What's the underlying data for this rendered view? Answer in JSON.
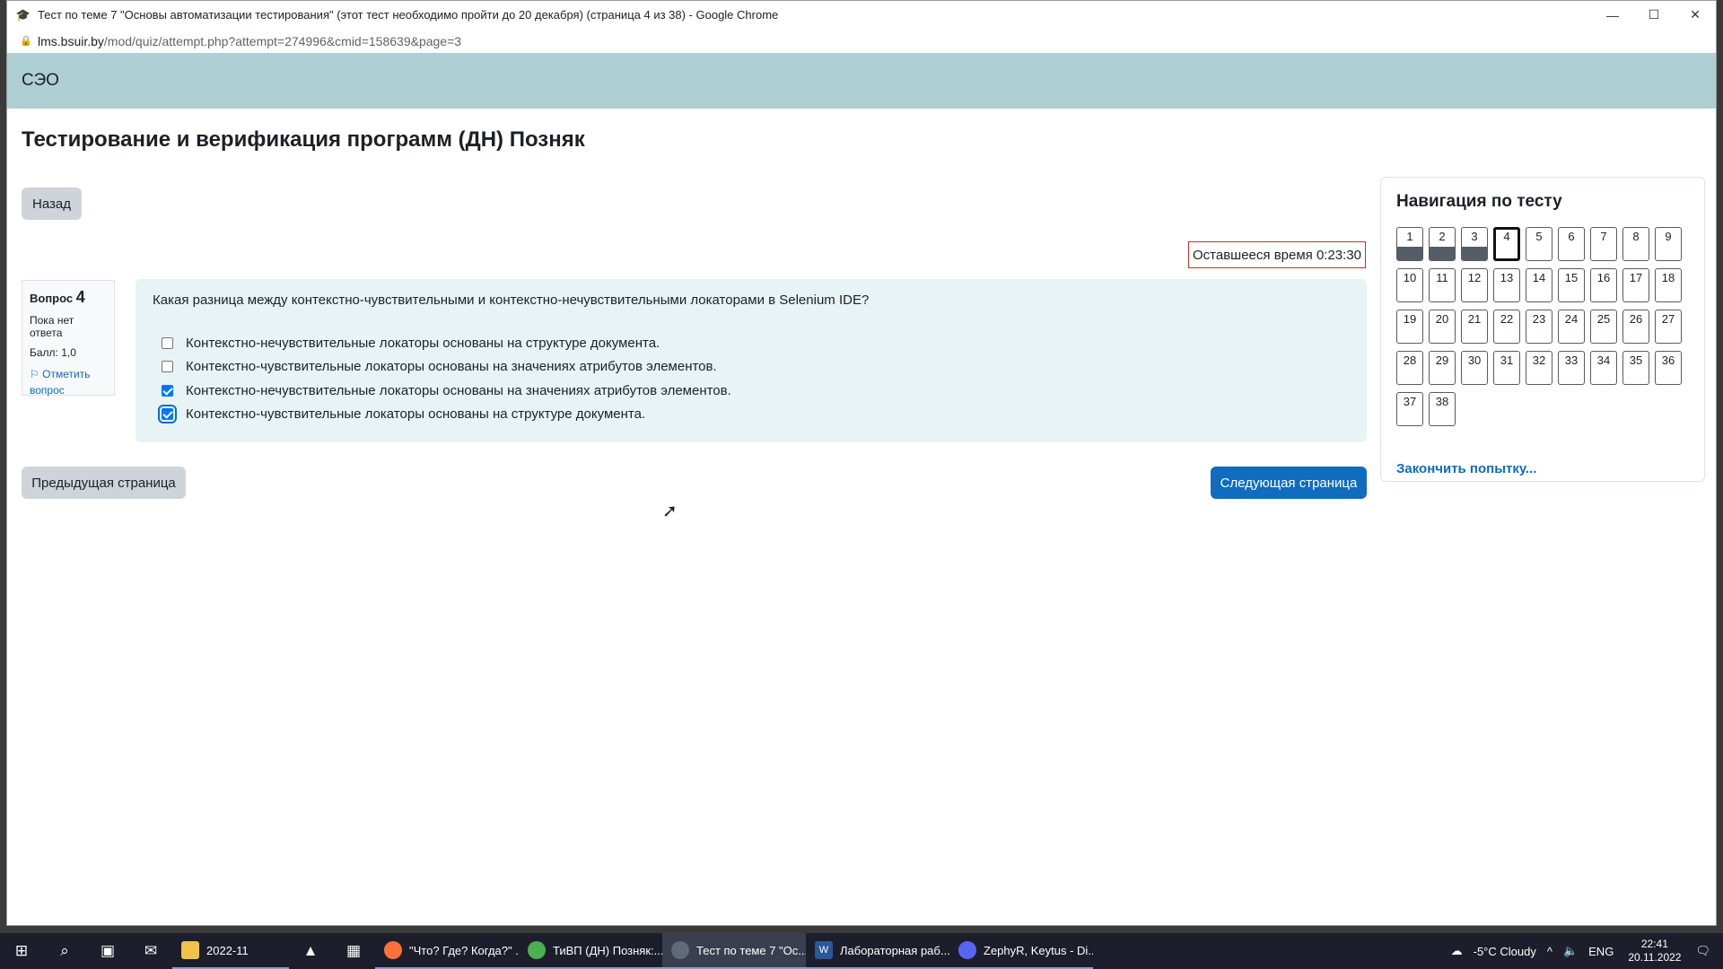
{
  "window": {
    "title": "Тест по теме 7 \"Основы автоматизации тестирования\" (этот тест необходимо пройти до 20 декабря) (страница 4 из 38) - Google Chrome",
    "url_host": "lms.bsuir.by",
    "url_path": "/mod/quiz/attempt.php?attempt=274996&cmid=158639&page=3",
    "controls": {
      "minimize": "—",
      "maximize": "☐",
      "close": "✕"
    }
  },
  "navbar": {
    "brand": "СЭО"
  },
  "course": {
    "title": "Тестирование и верификация программ (ДН) Позняк"
  },
  "back_button": "Назад",
  "timer": {
    "label": "Оставшееся время",
    "value": "0:23:30"
  },
  "question": {
    "label": "Вопрос",
    "number": "4",
    "state": "Пока нет ответа",
    "grade": "Балл: 1,0",
    "flag_line1": "Отметить",
    "flag_line2": "вопрос",
    "text": "Какая разница между контекстно-чувствительными и контекстно-нечувствительными локаторами в Selenium IDE?",
    "answers": [
      {
        "text": "Контекстно-нечувствительные локаторы основаны на структуре документа.",
        "checked": false
      },
      {
        "text": "Контекстно-чувствительные локаторы основаны на значениях атрибутов элементов.",
        "checked": false
      },
      {
        "text": "Контекстно-нечувствительные локаторы основаны на значениях атрибутов элементов.",
        "checked": true
      },
      {
        "text": "Контекстно-чувствительные локаторы основаны на структуре документа.",
        "checked": true
      }
    ]
  },
  "buttons": {
    "prev": "Предыдущая страница",
    "next": "Следующая страница"
  },
  "quiz_nav": {
    "title": "Навигация по тесту",
    "questions": [
      "1",
      "2",
      "3",
      "4",
      "5",
      "6",
      "7",
      "8",
      "9",
      "10",
      "11",
      "12",
      "13",
      "14",
      "15",
      "16",
      "17",
      "18",
      "19",
      "20",
      "21",
      "22",
      "23",
      "24",
      "25",
      "26",
      "27",
      "28",
      "29",
      "30",
      "31",
      "32",
      "33",
      "34",
      "35",
      "36",
      "37",
      "38"
    ],
    "answered": [
      "1",
      "2",
      "3"
    ],
    "current": "4",
    "finish": "Закончить попытку..."
  },
  "taskbar": {
    "items": [
      {
        "label": "2022-11",
        "icon": "folder-icon",
        "color": "#f0c24b"
      },
      {
        "label": "\"Что? Где? Когда?\" ...",
        "icon": "firefox-icon",
        "color": "#ff7139"
      },
      {
        "label": "ТиВП (ДН) Позняк:...",
        "icon": "chrome-icon",
        "color": "#4caf50"
      },
      {
        "label": "Тест по теме 7 \"Ос...",
        "icon": "chrome-icon",
        "color": "#5f6b7a"
      },
      {
        "label": "Лабораторная раб...",
        "icon": "word-icon",
        "color": "#2b5797"
      },
      {
        "label": "ZephyR, Keytus - Di...",
        "icon": "discord-icon",
        "color": "#5865f2"
      }
    ],
    "weather": "-5°C  Cloudy",
    "lang": "ENG",
    "time": "22:41",
    "date": "20.11.2022"
  }
}
